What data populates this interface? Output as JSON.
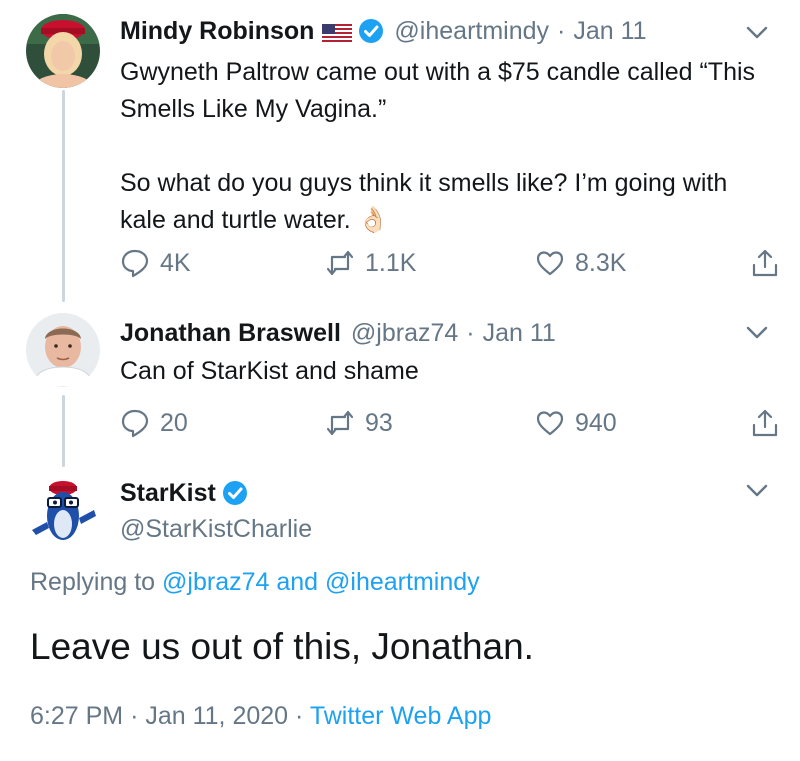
{
  "tweets": [
    {
      "name": "Mindy Robinson",
      "has_flag": true,
      "verified": true,
      "handle": "@iheartmindy",
      "date": "Jan 11",
      "text": "Gwyneth Paltrow came out with a $75 candle called “This Smells Like My Vagina.”\n\nSo what do you guys think it smells like? I’m going with kale and turtle water. 👌🏻",
      "replies": "4K",
      "retweets": "1.1K",
      "likes": "8.3K"
    },
    {
      "name": "Jonathan Braswell",
      "verified": false,
      "handle": "@jbraz74",
      "date": "Jan 11",
      "text": "Can of StarKist and shame",
      "replies": "20",
      "retweets": "93",
      "likes": "940"
    }
  ],
  "main_tweet": {
    "name": "StarKist",
    "verified": true,
    "handle": "@StarKistCharlie",
    "replying_prefix": "Replying to",
    "reply_user_1": "@jbraz74",
    "reply_and": "and",
    "reply_user_2": "@iheartmindy",
    "text": "Leave us out of this, Jonathan.",
    "time": "6:27 PM",
    "date": "Jan 11, 2020",
    "source": "Twitter Web App"
  },
  "colors": {
    "text": "#14171a",
    "muted": "#657786",
    "link": "#1da1f2",
    "verified": "#1da1f2",
    "thread_line": "#ccd6dd"
  },
  "icons": [
    "reply-icon",
    "retweet-icon",
    "like-icon",
    "share-icon",
    "verified-badge-icon",
    "us-flag-icon",
    "chevron-down-icon"
  ]
}
